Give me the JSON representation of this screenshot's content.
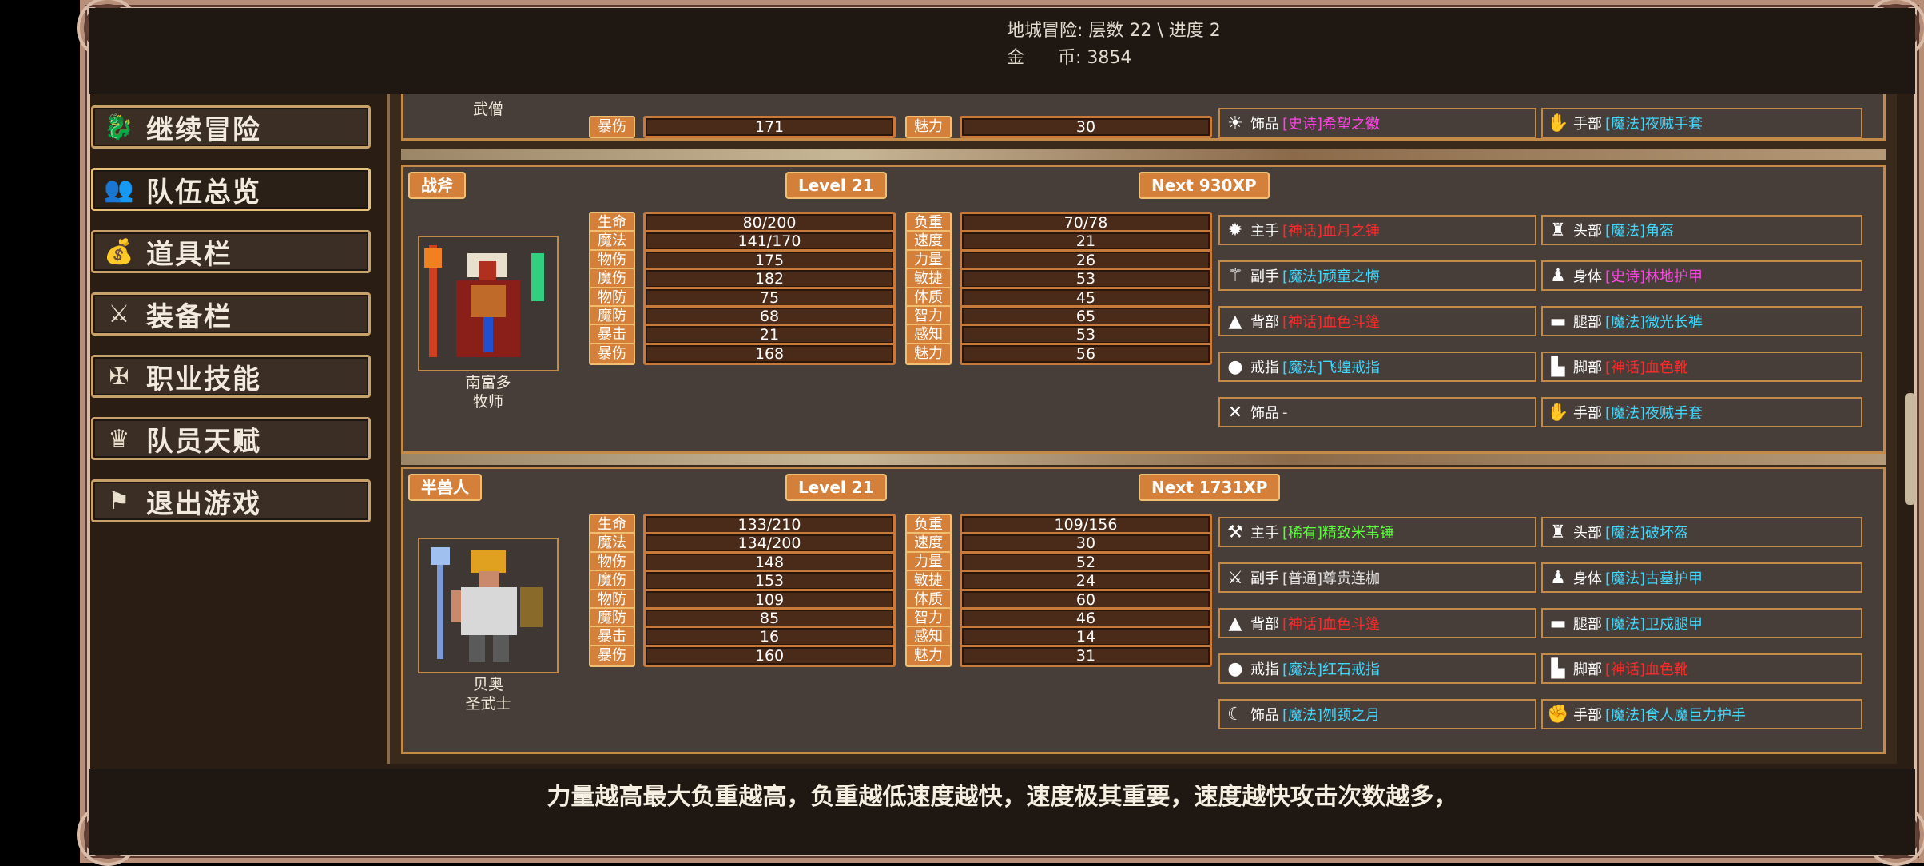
{
  "header": {
    "dungeon_line": "地城冒险: 层数 22 \\ 进度 2",
    "gold_line": "金      币: 3854"
  },
  "menu": [
    {
      "label": "继续冒险",
      "icon": "dragon-icon"
    },
    {
      "label": "队伍总览",
      "icon": "party-icon"
    },
    {
      "label": "道具栏",
      "icon": "bag-icon"
    },
    {
      "label": "装备栏",
      "icon": "equipment-icon"
    },
    {
      "label": "职业技能",
      "icon": "wings-sword-icon"
    },
    {
      "label": "队员天赋",
      "icon": "laurel-icon"
    },
    {
      "label": "退出游戏",
      "icon": "flag-icon"
    }
  ],
  "partial_char": {
    "class": "武僧",
    "stats": [
      {
        "label": "暴伤",
        "value": "171"
      },
      {
        "label": "魅力",
        "value": "30"
      }
    ],
    "equip": [
      {
        "slot": "饰品",
        "rarity": "[史诗]",
        "rarity_class": "epic",
        "name": "希望之徽",
        "icon": "medallion-icon"
      },
      {
        "slot": "手部",
        "rarity": "[魔法]",
        "rarity_class": "magic",
        "name": "夜贼手套",
        "icon": "glove-icon"
      }
    ]
  },
  "characters": [
    {
      "race": "战斧",
      "level": "Level 21",
      "next": "Next 930XP",
      "name": "南富多",
      "class": "牧师",
      "left_stats": [
        {
          "label": "生命",
          "value": "80/200"
        },
        {
          "label": "魔法",
          "value": "141/170"
        },
        {
          "label": "物伤",
          "value": "175"
        },
        {
          "label": "魔伤",
          "value": "182"
        },
        {
          "label": "物防",
          "value": "75"
        },
        {
          "label": "魔防",
          "value": "68"
        },
        {
          "label": "暴击",
          "value": "21"
        },
        {
          "label": "暴伤",
          "value": "168"
        }
      ],
      "right_stats": [
        {
          "label": "负重",
          "value": "70/78"
        },
        {
          "label": "速度",
          "value": "21"
        },
        {
          "label": "力量",
          "value": "26"
        },
        {
          "label": "敏捷",
          "value": "53"
        },
        {
          "label": "体质",
          "value": "45"
        },
        {
          "label": "智力",
          "value": "65"
        },
        {
          "label": "感知",
          "value": "53"
        },
        {
          "label": "魅力",
          "value": "56"
        }
      ],
      "equip_left": [
        {
          "slot": "主手",
          "rarity": "[神话]",
          "rarity_class": "legendary",
          "name": "血月之锤",
          "icon": "mace-icon"
        },
        {
          "slot": "副手",
          "rarity": "[魔法]",
          "rarity_class": "magic",
          "name": "顽童之悔",
          "icon": "wand-icon"
        },
        {
          "slot": "背部",
          "rarity": "[神话]",
          "rarity_class": "legendary",
          "name": "血色斗篷",
          "icon": "cloak-icon"
        },
        {
          "slot": "戒指",
          "rarity": "[魔法]",
          "rarity_class": "magic",
          "name": "飞蝗戒指",
          "icon": "ring-icon"
        },
        {
          "slot": "饰品",
          "rarity": "",
          "rarity_class": "common",
          "name": "-",
          "icon": "crossed-tools-icon"
        }
      ],
      "equip_right": [
        {
          "slot": "头部",
          "rarity": "[魔法]",
          "rarity_class": "magic",
          "name": "角盔",
          "icon": "horned-helmet-icon"
        },
        {
          "slot": "身体",
          "rarity": "[史诗]",
          "rarity_class": "epic",
          "name": "林地护甲",
          "icon": "armor-icon"
        },
        {
          "slot": "腿部",
          "rarity": "[魔法]",
          "rarity_class": "magic",
          "name": "微光长裤",
          "icon": "pants-icon"
        },
        {
          "slot": "脚部",
          "rarity": "[神话]",
          "rarity_class": "legendary",
          "name": "血色靴",
          "icon": "boots-icon"
        },
        {
          "slot": "手部",
          "rarity": "[魔法]",
          "rarity_class": "magic",
          "name": "夜贼手套",
          "icon": "glove-icon"
        }
      ]
    },
    {
      "race": "半兽人",
      "level": "Level 21",
      "next": "Next 1731XP",
      "name": "贝奥",
      "class": "圣武士",
      "left_stats": [
        {
          "label": "生命",
          "value": "133/210"
        },
        {
          "label": "魔法",
          "value": "134/200"
        },
        {
          "label": "物伤",
          "value": "148"
        },
        {
          "label": "魔伤",
          "value": "153"
        },
        {
          "label": "物防",
          "value": "109"
        },
        {
          "label": "魔防",
          "value": "85"
        },
        {
          "label": "暴击",
          "value": "16"
        },
        {
          "label": "暴伤",
          "value": "160"
        }
      ],
      "right_stats": [
        {
          "label": "负重",
          "value": "109/156"
        },
        {
          "label": "速度",
          "value": "30"
        },
        {
          "label": "力量",
          "value": "52"
        },
        {
          "label": "敏捷",
          "value": "24"
        },
        {
          "label": "体质",
          "value": "60"
        },
        {
          "label": "智力",
          "value": "46"
        },
        {
          "label": "感知",
          "value": "14"
        },
        {
          "label": "魅力",
          "value": "31"
        }
      ],
      "equip_left": [
        {
          "slot": "主手",
          "rarity": "[稀有]",
          "rarity_class": "rare",
          "name": "精致米苇锤",
          "icon": "hammer-icon"
        },
        {
          "slot": "副手",
          "rarity": "[普通]",
          "rarity_class": "common",
          "name": "尊贵连枷",
          "icon": "flail-icon"
        },
        {
          "slot": "背部",
          "rarity": "[神话]",
          "rarity_class": "legendary",
          "name": "血色斗篷",
          "icon": "cloak-icon"
        },
        {
          "slot": "戒指",
          "rarity": "[魔法]",
          "rarity_class": "magic",
          "name": "红石戒指",
          "icon": "ring-icon"
        },
        {
          "slot": "饰品",
          "rarity": "[魔法]",
          "rarity_class": "magic",
          "name": "刎颈之月",
          "icon": "amulet-icon"
        }
      ],
      "equip_right": [
        {
          "slot": "头部",
          "rarity": "[魔法]",
          "rarity_class": "magic",
          "name": "破坏盔",
          "icon": "horned-helmet-icon"
        },
        {
          "slot": "身体",
          "rarity": "[魔法]",
          "rarity_class": "magic",
          "name": "古墓护甲",
          "icon": "armor-icon"
        },
        {
          "slot": "腿部",
          "rarity": "[魔法]",
          "rarity_class": "magic",
          "name": "卫戍腿甲",
          "icon": "pants-icon"
        },
        {
          "slot": "脚部",
          "rarity": "[神话]",
          "rarity_class": "legendary",
          "name": "血色靴",
          "icon": "boots-icon"
        },
        {
          "slot": "手部",
          "rarity": "[魔法]",
          "rarity_class": "magic",
          "name": "食人魔巨力护手",
          "icon": "gauntlet-icon"
        }
      ]
    }
  ],
  "tip": "力量越高最大负重越高，负重越低速度越快，速度极其重要，速度越快攻击次数越多，"
}
